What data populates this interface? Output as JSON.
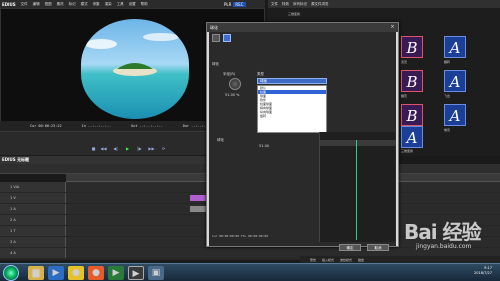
{
  "app": {
    "name": "EDIUS",
    "pl_label": "PLR",
    "rec_label": "REC"
  },
  "menu": [
    "文件",
    "编辑",
    "视图",
    "素材",
    "标记",
    "模式",
    "采集",
    "渲染",
    "工具",
    "设置",
    "帮助"
  ],
  "player": {
    "tc_cur": "Cur 00:00:23:22",
    "tc_in": "In --:--:--:--",
    "tc_out": "Out --:--:--:--",
    "tc_dur": "Dur --:--:--:--"
  },
  "bin": {
    "tabs": [
      "文件",
      "特效",
      "序列标记",
      "源文件浏览"
    ],
    "folder": "三维变换",
    "tiles": [
      {
        "glyph": "B",
        "label": "双页"
      },
      {
        "glyph": "A",
        "label": "翻转"
      },
      {
        "glyph": "B",
        "label": "翻页"
      },
      {
        "glyph": "A",
        "label": "飞出"
      },
      {
        "glyph": "B",
        "label": "球化"
      },
      {
        "glyph": "A",
        "label": "卷页"
      },
      {
        "glyph": "A",
        "label": "三维变换"
      }
    ]
  },
  "dialog": {
    "title": "球化",
    "close": "×",
    "section": "球化",
    "radius_label": "半径(R)",
    "dropdown_label": "类型",
    "dropdown_value": "球面",
    "radius_value": "51.00 %",
    "options": [
      "默认",
      "柱面",
      "球面",
      "软件",
      "柱面球面",
      "横向球面",
      "纵向球面",
      "旋转"
    ],
    "selected_option": 1,
    "track_label": "球化",
    "track_value": "51.00",
    "tc_cur": "Cur 00:00:00:00",
    "tc_tl": "TTL 00:00:00:00",
    "ok": "确定",
    "cancel": "取消"
  },
  "timeline": {
    "title": "EDIUS 无标题",
    "tracks": [
      "1 V/A",
      "1 V",
      "1 A",
      "2 A",
      "1 T",
      "3 A",
      "4 A"
    ]
  },
  "status": [
    "警告",
    "插入模式",
    "波纹模式",
    "磁盘"
  ],
  "clock": {
    "time": "9:17",
    "date": "2018/7/27"
  },
  "taskbar": {
    "icons": [
      "windows-explorer",
      "media-player",
      "chrome",
      "firefox",
      "edius",
      "pinnacle",
      "other"
    ]
  },
  "watermark": {
    "text": "Bai 经验",
    "url": "jingyan.baidu.com"
  }
}
